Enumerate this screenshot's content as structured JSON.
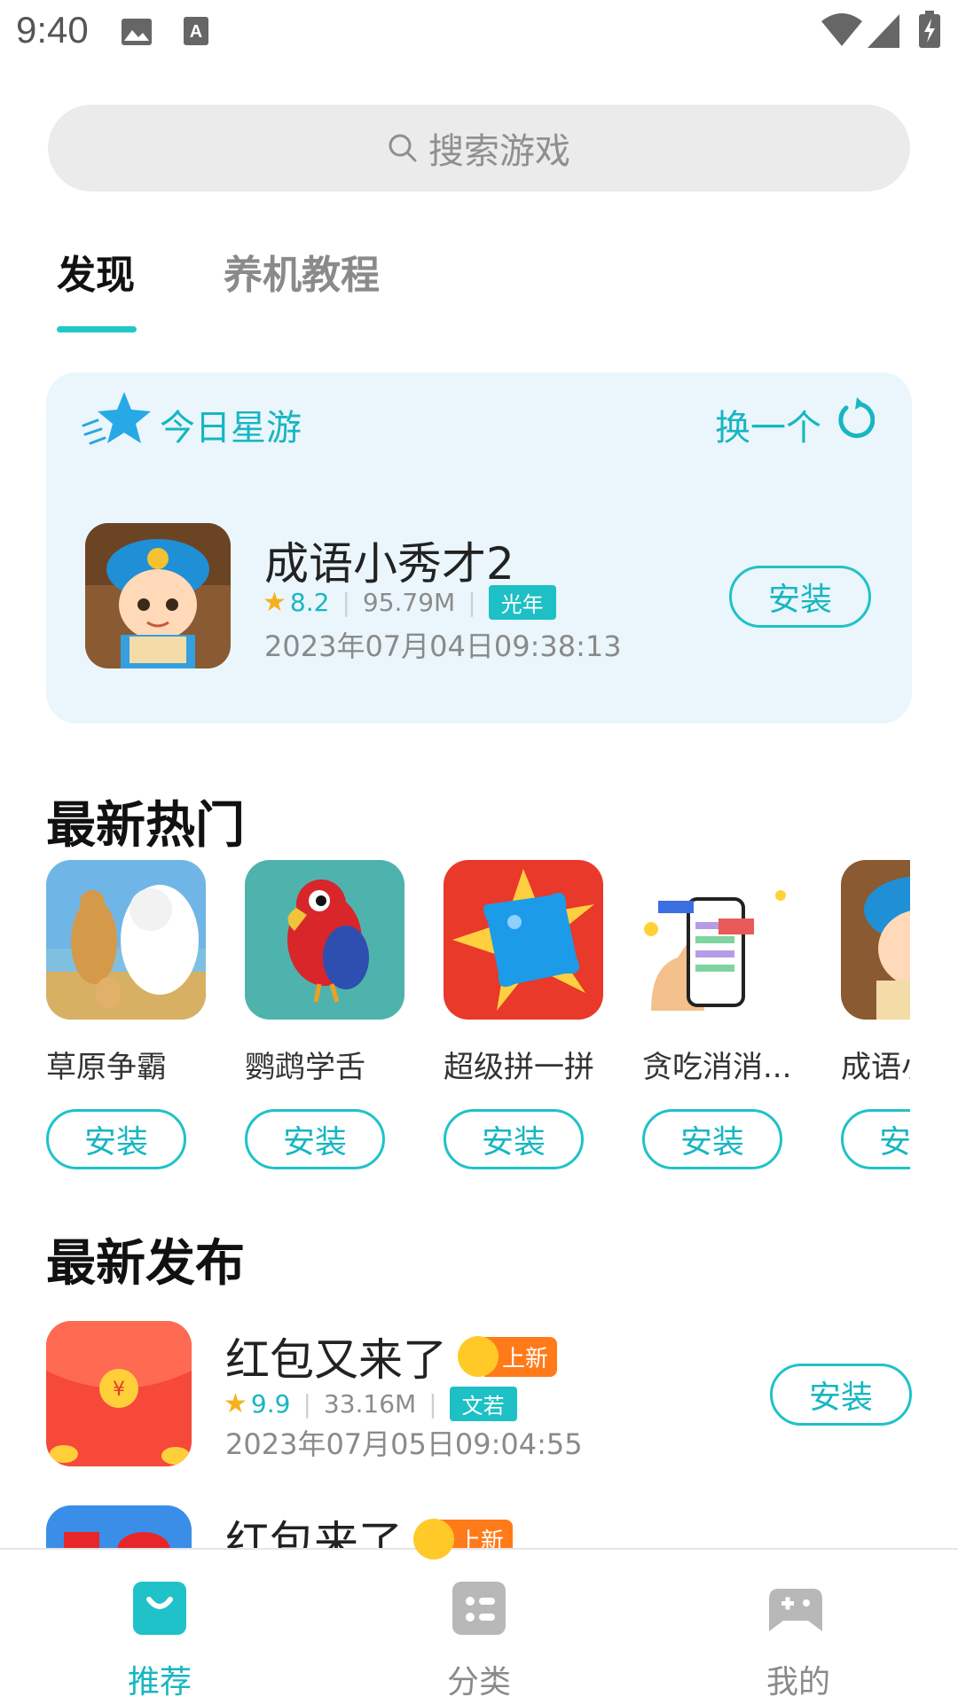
{
  "status_bar": {
    "time": "9:40"
  },
  "search": {
    "placeholder": "搜索游戏"
  },
  "tabs": [
    {
      "label": "发现",
      "active": true
    },
    {
      "label": "养机教程",
      "active": false
    }
  ],
  "daily": {
    "title": "今日星游",
    "refresh_label": "换一个",
    "app": {
      "name": "成语小秀才2",
      "rating": "8.2",
      "size": "95.79M",
      "tag": "光年",
      "date": "2023年07月04日09:38:13",
      "install_label": "安装"
    }
  },
  "hot": {
    "title": "最新热门",
    "items": [
      {
        "name": "草原争霸",
        "install_label": "安装"
      },
      {
        "name": "鹦鹉学舌",
        "install_label": "安装"
      },
      {
        "name": "超级拼一拼",
        "install_label": "安装"
      },
      {
        "name": "贪吃消消...",
        "install_label": "安装"
      },
      {
        "name": "成语小",
        "install_label": "安装"
      }
    ]
  },
  "new_release": {
    "title": "最新发布",
    "items": [
      {
        "name": "红包又来了",
        "badge": "上新",
        "rating": "9.9",
        "size": "33.16M",
        "tag": "文若",
        "date": "2023年07月05日09:04:55",
        "install_label": "安装"
      },
      {
        "name": "红包来了",
        "badge": "上新"
      }
    ]
  },
  "bottom_nav": [
    {
      "label": "推荐",
      "icon": "smile-box-icon",
      "active": true
    },
    {
      "label": "分类",
      "icon": "grid-icon",
      "active": false
    },
    {
      "label": "我的",
      "icon": "gamepad-icon",
      "active": false
    }
  ],
  "colors": {
    "accent": "#1fc2c8",
    "card_bg": "#eaf6fb",
    "badge_orange": "#ff7b1a",
    "star": "#f5b11e"
  }
}
